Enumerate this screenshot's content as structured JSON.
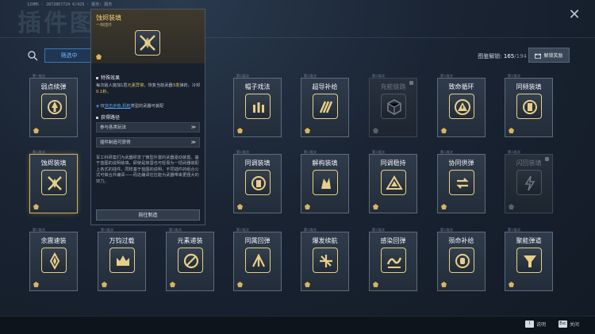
{
  "header": {
    "bg_title": "插件图鉴",
    "id_text": "120MS · 2872867724 6/429 · 服务: 服务",
    "close_icon": "close-icon"
  },
  "toolbar": {
    "filter_label": "筛选中",
    "progress_label": "图鉴解锁:",
    "progress_value": "165",
    "progress_total": "/194",
    "reward_label": "解锁奖励"
  },
  "cards": [
    {
      "name": "弱点续弹",
      "tag": "第一批次",
      "locked": false,
      "icon": "weakpoint-icon"
    },
    {
      "name": "",
      "tag": "",
      "locked": false,
      "icon": ""
    },
    {
      "name": "",
      "tag": "",
      "locked": false,
      "icon": ""
    },
    {
      "name": "帽子戏法",
      "tag": "第二批次",
      "locked": false,
      "icon": "bullets-icon"
    },
    {
      "name": "超导补给",
      "tag": "第二批次",
      "locked": false,
      "icon": "stripes-icon"
    },
    {
      "name": "充能链路",
      "tag": "第二批次",
      "locked": true,
      "icon": "cube-icon"
    },
    {
      "name": "致命循环",
      "tag": "第二批次",
      "locked": false,
      "icon": "warning-icon"
    },
    {
      "name": "同频装填",
      "tag": "第二批次",
      "locked": false,
      "icon": "sync-icon"
    },
    {
      "name": "蚀烬装填",
      "tag": "第二批次",
      "locked": false,
      "icon": "crossed-swords-icon"
    },
    {
      "name": "",
      "tag": "",
      "locked": false,
      "icon": ""
    },
    {
      "name": "",
      "tag": "",
      "locked": false,
      "icon": ""
    },
    {
      "name": "同调装填",
      "tag": "第二批次",
      "locked": false,
      "icon": "target-icon"
    },
    {
      "name": "解构装填",
      "tag": "第二批次",
      "locked": false,
      "icon": "shatter-icon"
    },
    {
      "name": "同调稳持",
      "tag": "第二批次",
      "locked": false,
      "icon": "triangle-icon"
    },
    {
      "name": "协同供弹",
      "tag": "第二批次",
      "locked": false,
      "icon": "swap-icon"
    },
    {
      "name": "闪回装填",
      "tag": "第二批次",
      "locked": true,
      "icon": "flash-icon"
    },
    {
      "name": "余震速装",
      "tag": "第二批次",
      "locked": false,
      "icon": "spike-icon"
    },
    {
      "name": "万钧过载",
      "tag": "第二批次",
      "locked": false,
      "icon": "crown-icon"
    },
    {
      "name": "元素递装",
      "tag": "第二批次",
      "locked": false,
      "icon": "no-sign-icon"
    },
    {
      "name": "同属回弹",
      "tag": "第二批次",
      "locked": false,
      "icon": "arrows-icon"
    },
    {
      "name": "爆发续航",
      "tag": "第二批次",
      "locked": false,
      "icon": "scatter-icon"
    },
    {
      "name": "感染回弹",
      "tag": "第二批次",
      "locked": false,
      "icon": "wave-icon"
    },
    {
      "name": "殒命补给",
      "tag": "第二批次",
      "locked": false,
      "icon": "hand-icon"
    },
    {
      "name": "聚能弹道",
      "tag": "第二批次",
      "locked": false,
      "icon": "funnel-icon"
    }
  ],
  "panel": {
    "name": "蚀烬装填",
    "sub": "一档插件",
    "effect_title": "特殊效果",
    "effect_pre": "每次敌人施加1层",
    "effect_hl1": "元素异常",
    "effect_mid": "，恢复当前武器",
    "effect_hl2": "3发",
    "effect_post": "弹药，冷却",
    "effect_hl3": "0.1秒",
    "effect_end": "。",
    "usage_pre": "仅",
    "usage_link": "突击步枪,机枪",
    "usage_post": "类型的武器可装配",
    "route_title": "获得路径",
    "route1": "参与各类玩法",
    "route2": "插件制造可获得",
    "desc": "军工科研案们为武器研发了微型外置的武器驱动装置。基于蓝图的说明装填，即使是抹蛋也可轻易为一把武器装配上各式的插件。同样基于蓝图的说明，不同插件的组合公式可做合并编译——而这编译往往能为武器带来更强大的效力。",
    "goto": "前往制造"
  },
  "footer": {
    "help_key": "I",
    "help_label": "说明",
    "close_key": "Esc",
    "close_label": "关闭"
  },
  "colors": {
    "accent_gold": "#d6b460",
    "link_blue": "#58a6ff",
    "filter_blue": "#6fb4ff"
  }
}
